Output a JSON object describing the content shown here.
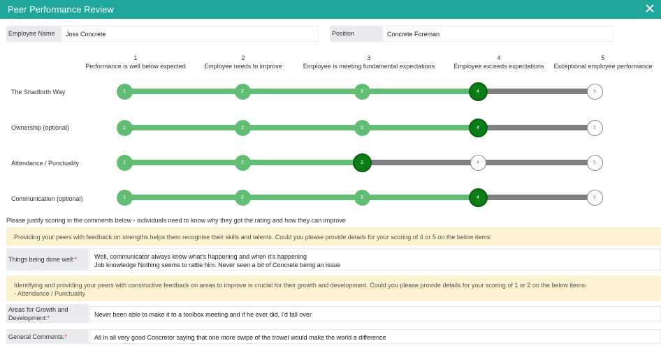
{
  "window": {
    "title": "Peer Performance Review",
    "close_icon": "close-icon"
  },
  "employee": {
    "name_label": "Employee Name",
    "name_value": "Joss Concrete",
    "position_label": "Position",
    "position_value": "Concrete Foreman"
  },
  "scale": [
    {
      "num": "1",
      "text": "Performance is well below expected"
    },
    {
      "num": "2",
      "text": "Employee needs to improve"
    },
    {
      "num": "3",
      "text": "Employee is meeting fundamental expectations"
    },
    {
      "num": "4",
      "text": "Employee exceeds expectations"
    },
    {
      "num": "5",
      "text": "Exceptional employee performance"
    }
  ],
  "ratings": [
    {
      "label": "The Shadforth Way",
      "value": 4,
      "nodes": [
        "1",
        "2",
        "3",
        "4",
        "5"
      ]
    },
    {
      "label": "Ownership (optional)",
      "value": 4,
      "nodes": [
        "1",
        "2",
        "3",
        "4",
        "5"
      ]
    },
    {
      "label": "Attendance / Punctuality",
      "value": 3,
      "nodes": [
        "1",
        "2",
        "3",
        "4",
        "5"
      ]
    },
    {
      "label": "Communication (optional)",
      "value": 4,
      "nodes": [
        "1",
        "2",
        "3",
        "4",
        "5"
      ]
    }
  ],
  "colors": {
    "accent": "#1fa79b",
    "track_on": "#62bd74",
    "track_off": "#808080",
    "selected": "#0b7d17",
    "notice_bg": "#fdf2cf"
  },
  "justify_text": "Please justify scoring in the comments below - individuals need to know why they got the rating and how they can improve",
  "notice_strengths": "Providing your peers with feedback on strengths helps them recognise their skills and talents. Could you please provide details for your scoring of 4 or 5 on the below items:",
  "notice_improve": {
    "line1": "Identifying and providing your peers with constructive feedback on areas to improve is crucial for their growth and development. Could you please provide details for your scoring of 1 or 2 on the below items:",
    "line2": "- Attendance / Punctuality"
  },
  "comments": {
    "done_well": {
      "label": "Things being done well:",
      "req": "*",
      "line1": "Well, communicator always know what's happening and when it's happening",
      "line2": "Job knowledge Nothing seems to rattle him. Never seen a bit of Concrete being an issue"
    },
    "growth": {
      "label_1": "Areas for Growth and",
      "label_2": "Development:",
      "req": "*",
      "value": "Never been able to make it to a toolbox meeting and if he ever did, I'd fall over"
    },
    "general": {
      "label": "General Comments:",
      "req": "*",
      "value": "All in all very good Concretor saying that one more swipe of the trowel  would make the world a difference"
    }
  }
}
